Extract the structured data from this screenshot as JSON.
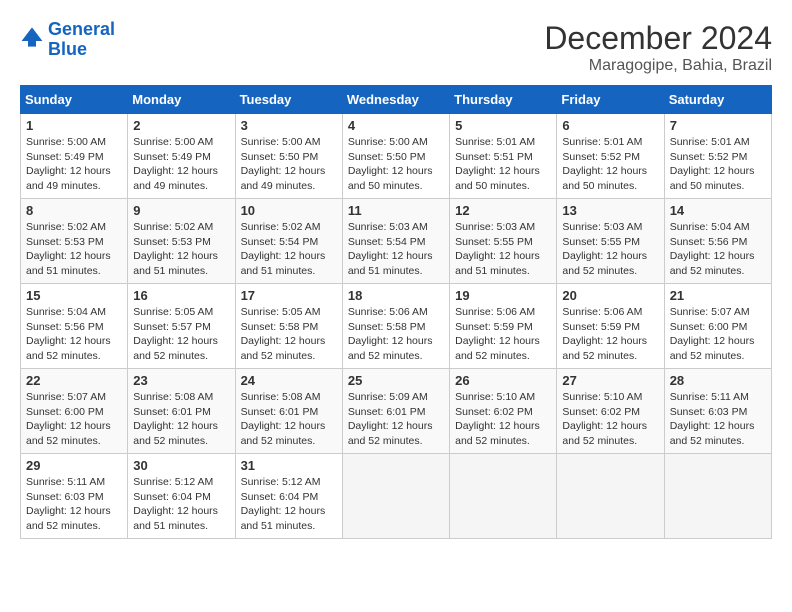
{
  "header": {
    "logo_line1": "General",
    "logo_line2": "Blue",
    "month": "December 2024",
    "location": "Maragogipe, Bahia, Brazil"
  },
  "weekdays": [
    "Sunday",
    "Monday",
    "Tuesday",
    "Wednesday",
    "Thursday",
    "Friday",
    "Saturday"
  ],
  "weeks": [
    [
      {
        "day": "1",
        "sunrise": "5:00 AM",
        "sunset": "5:49 PM",
        "daylight": "12 hours and 49 minutes."
      },
      {
        "day": "2",
        "sunrise": "5:00 AM",
        "sunset": "5:49 PM",
        "daylight": "12 hours and 49 minutes."
      },
      {
        "day": "3",
        "sunrise": "5:00 AM",
        "sunset": "5:50 PM",
        "daylight": "12 hours and 49 minutes."
      },
      {
        "day": "4",
        "sunrise": "5:00 AM",
        "sunset": "5:50 PM",
        "daylight": "12 hours and 50 minutes."
      },
      {
        "day": "5",
        "sunrise": "5:01 AM",
        "sunset": "5:51 PM",
        "daylight": "12 hours and 50 minutes."
      },
      {
        "day": "6",
        "sunrise": "5:01 AM",
        "sunset": "5:52 PM",
        "daylight": "12 hours and 50 minutes."
      },
      {
        "day": "7",
        "sunrise": "5:01 AM",
        "sunset": "5:52 PM",
        "daylight": "12 hours and 50 minutes."
      }
    ],
    [
      {
        "day": "8",
        "sunrise": "5:02 AM",
        "sunset": "5:53 PM",
        "daylight": "12 hours and 51 minutes."
      },
      {
        "day": "9",
        "sunrise": "5:02 AM",
        "sunset": "5:53 PM",
        "daylight": "12 hours and 51 minutes."
      },
      {
        "day": "10",
        "sunrise": "5:02 AM",
        "sunset": "5:54 PM",
        "daylight": "12 hours and 51 minutes."
      },
      {
        "day": "11",
        "sunrise": "5:03 AM",
        "sunset": "5:54 PM",
        "daylight": "12 hours and 51 minutes."
      },
      {
        "day": "12",
        "sunrise": "5:03 AM",
        "sunset": "5:55 PM",
        "daylight": "12 hours and 51 minutes."
      },
      {
        "day": "13",
        "sunrise": "5:03 AM",
        "sunset": "5:55 PM",
        "daylight": "12 hours and 52 minutes."
      },
      {
        "day": "14",
        "sunrise": "5:04 AM",
        "sunset": "5:56 PM",
        "daylight": "12 hours and 52 minutes."
      }
    ],
    [
      {
        "day": "15",
        "sunrise": "5:04 AM",
        "sunset": "5:56 PM",
        "daylight": "12 hours and 52 minutes."
      },
      {
        "day": "16",
        "sunrise": "5:05 AM",
        "sunset": "5:57 PM",
        "daylight": "12 hours and 52 minutes."
      },
      {
        "day": "17",
        "sunrise": "5:05 AM",
        "sunset": "5:58 PM",
        "daylight": "12 hours and 52 minutes."
      },
      {
        "day": "18",
        "sunrise": "5:06 AM",
        "sunset": "5:58 PM",
        "daylight": "12 hours and 52 minutes."
      },
      {
        "day": "19",
        "sunrise": "5:06 AM",
        "sunset": "5:59 PM",
        "daylight": "12 hours and 52 minutes."
      },
      {
        "day": "20",
        "sunrise": "5:06 AM",
        "sunset": "5:59 PM",
        "daylight": "12 hours and 52 minutes."
      },
      {
        "day": "21",
        "sunrise": "5:07 AM",
        "sunset": "6:00 PM",
        "daylight": "12 hours and 52 minutes."
      }
    ],
    [
      {
        "day": "22",
        "sunrise": "5:07 AM",
        "sunset": "6:00 PM",
        "daylight": "12 hours and 52 minutes."
      },
      {
        "day": "23",
        "sunrise": "5:08 AM",
        "sunset": "6:01 PM",
        "daylight": "12 hours and 52 minutes."
      },
      {
        "day": "24",
        "sunrise": "5:08 AM",
        "sunset": "6:01 PM",
        "daylight": "12 hours and 52 minutes."
      },
      {
        "day": "25",
        "sunrise": "5:09 AM",
        "sunset": "6:01 PM",
        "daylight": "12 hours and 52 minutes."
      },
      {
        "day": "26",
        "sunrise": "5:10 AM",
        "sunset": "6:02 PM",
        "daylight": "12 hours and 52 minutes."
      },
      {
        "day": "27",
        "sunrise": "5:10 AM",
        "sunset": "6:02 PM",
        "daylight": "12 hours and 52 minutes."
      },
      {
        "day": "28",
        "sunrise": "5:11 AM",
        "sunset": "6:03 PM",
        "daylight": "12 hours and 52 minutes."
      }
    ],
    [
      {
        "day": "29",
        "sunrise": "5:11 AM",
        "sunset": "6:03 PM",
        "daylight": "12 hours and 52 minutes."
      },
      {
        "day": "30",
        "sunrise": "5:12 AM",
        "sunset": "6:04 PM",
        "daylight": "12 hours and 51 minutes."
      },
      {
        "day": "31",
        "sunrise": "5:12 AM",
        "sunset": "6:04 PM",
        "daylight": "12 hours and 51 minutes."
      },
      null,
      null,
      null,
      null
    ]
  ]
}
